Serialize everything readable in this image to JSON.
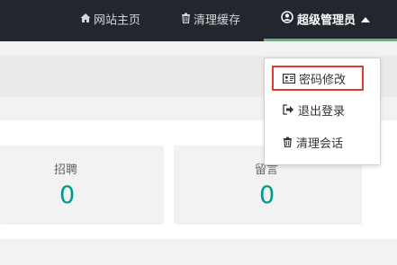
{
  "topbar": {
    "home_label": "网站主页",
    "cache_label": "清理缓存",
    "admin_label": "超级管理员",
    "home_icon": "home-icon",
    "cache_icon": "trash-icon",
    "admin_icon": "user-circle-icon"
  },
  "dropdown": {
    "items": [
      {
        "label": "密码修改",
        "icon": "id-card-icon"
      },
      {
        "label": "退出登录",
        "icon": "sign-out-icon"
      },
      {
        "label": "清理会话",
        "icon": "trash-icon"
      }
    ]
  },
  "stats": [
    {
      "label": "招聘",
      "value": "0"
    },
    {
      "label": "留言",
      "value": "0"
    }
  ],
  "colors": {
    "topbar_bg": "#23262e",
    "active_bar": "#5fb878",
    "stat_value": "#009688",
    "highlight": "#e53935"
  }
}
